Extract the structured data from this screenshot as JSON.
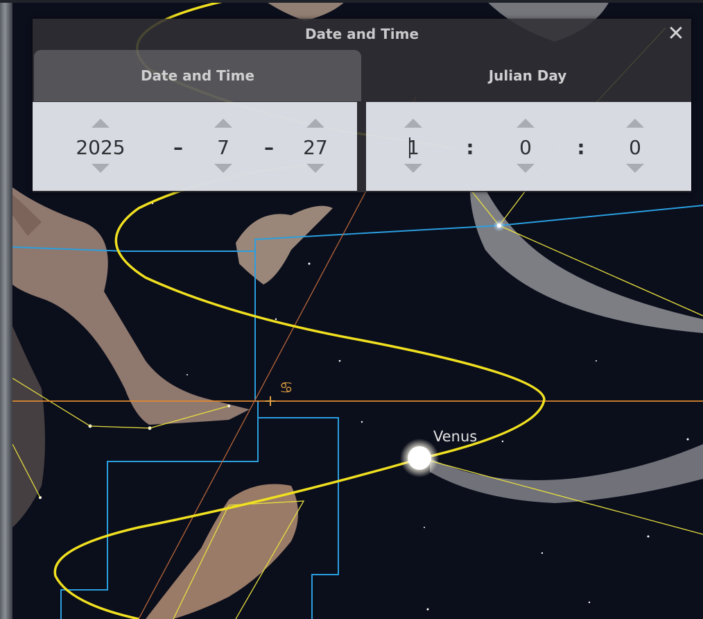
{
  "dialog": {
    "title": "Date and Time",
    "close_label": "✕",
    "tabs": [
      {
        "label": "Date and Time",
        "active": true
      },
      {
        "label": "Julian Day",
        "active": false
      }
    ],
    "date": {
      "year": "2025",
      "month": "7",
      "day": "27",
      "separator": "–"
    },
    "time": {
      "hour": "1",
      "minute": "0",
      "second": "0",
      "separator": ":"
    }
  },
  "sky": {
    "planet_label": "Venus",
    "constellation_symbol": "♋"
  },
  "colors": {
    "ecliptic": "#f0e020",
    "constellation_boundary": "#2a9fe0",
    "horizon_line": "#e08a30",
    "constellation_lines": "#e8e040",
    "dialog_bg": "#303034",
    "panel_bg": "#e2e5ec"
  },
  "icons": {
    "close": "close-icon",
    "increment": "chevron-up-icon",
    "decrement": "chevron-down-icon"
  }
}
